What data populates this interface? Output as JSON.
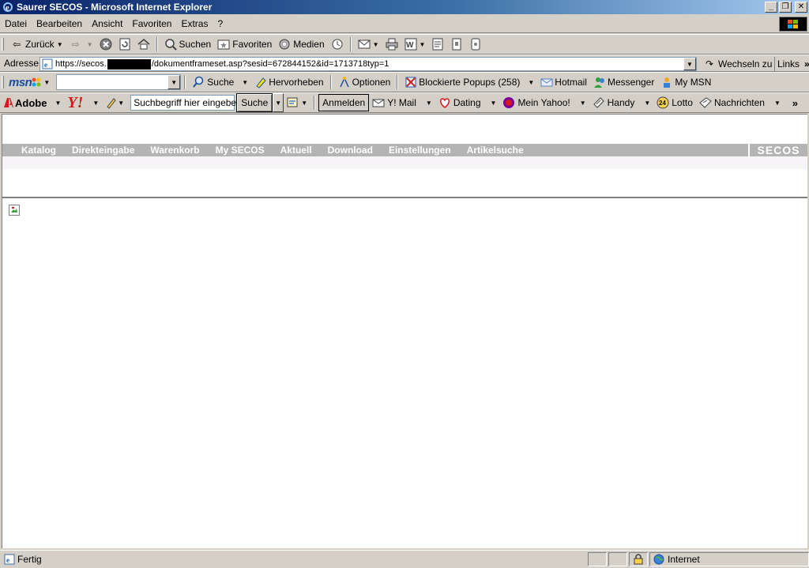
{
  "window": {
    "title": "Saurer SECOS - Microsoft Internet Explorer"
  },
  "menu": [
    "Datei",
    "Bearbeiten",
    "Ansicht",
    "Favoriten",
    "Extras",
    "?"
  ],
  "toolbar": {
    "back": "Zurück",
    "search": "Suchen",
    "favorites": "Favoriten",
    "media": "Medien"
  },
  "address": {
    "label": "Adresse",
    "url_prefix": "https://secos.",
    "url_suffix": "/dokumentframeset.asp?sesid=672844152&id=1713718typ=1",
    "go": "Wechseln zu",
    "links": "Links"
  },
  "msn": {
    "logo": "msn",
    "search": "Suche",
    "highlight": "Hervorheben",
    "options": "Optionen",
    "popups": "Blockierte Popups (258)",
    "hotmail": "Hotmail",
    "messenger": "Messenger",
    "mymsn": "My MSN"
  },
  "yahoo": {
    "adobe": "Adobe",
    "logo": "Y!",
    "search_placeholder": "Suchbegriff hier eingeben",
    "search_button": "Suche",
    "login": "Anmelden",
    "mail": "Y! Mail",
    "dating": "Dating",
    "myyahoo": "Mein Yahoo!",
    "handy": "Handy",
    "lotto": "Lotto",
    "news": "Nachrichten"
  },
  "site_nav": [
    "Katalog",
    "Direkteingabe",
    "Warenkorb",
    "My SECOS",
    "Aktuell",
    "Download",
    "Einstellungen",
    "Artikelsuche"
  ],
  "brand": "SECOS",
  "status": {
    "text": "Fertig",
    "zone": "Internet"
  }
}
